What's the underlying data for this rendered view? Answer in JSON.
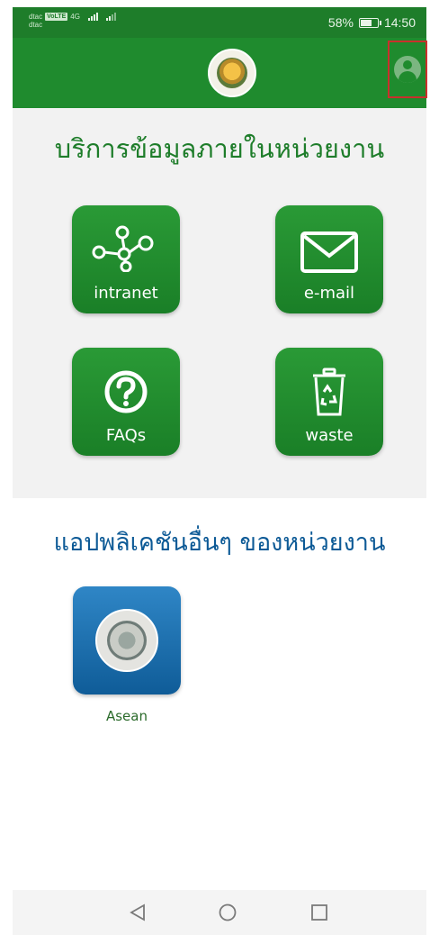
{
  "status_bar": {
    "carrier_primary": "dtac",
    "carrier_secondary": "dtac",
    "volte_badge": "VoLTE",
    "network": "4G",
    "battery_percent": "58%",
    "time": "14:50"
  },
  "app_bar": {
    "logo_icon": "department-seal-logo",
    "profile_icon": "user-profile-icon"
  },
  "internal_services": {
    "title": "บริการข้อมูลภายในหน่วยงาน",
    "tiles": [
      {
        "label": "intranet",
        "icon": "network-nodes-icon"
      },
      {
        "label": "e-mail",
        "icon": "envelope-icon"
      },
      {
        "label": "FAQs",
        "icon": "question-circle-icon"
      },
      {
        "label": "waste",
        "icon": "recycle-bin-icon"
      }
    ]
  },
  "other_apps": {
    "title": "แอปพลิเคชันอื่นๆ ของหน่วยงาน",
    "apps": [
      {
        "label": "Asean",
        "icon": "asean-seal-icon"
      }
    ]
  },
  "colors": {
    "primary_green": "#1f8b2e",
    "status_green": "#1e7d2a",
    "title_blue": "#0d5a96",
    "highlight_red": "#c9302c"
  }
}
